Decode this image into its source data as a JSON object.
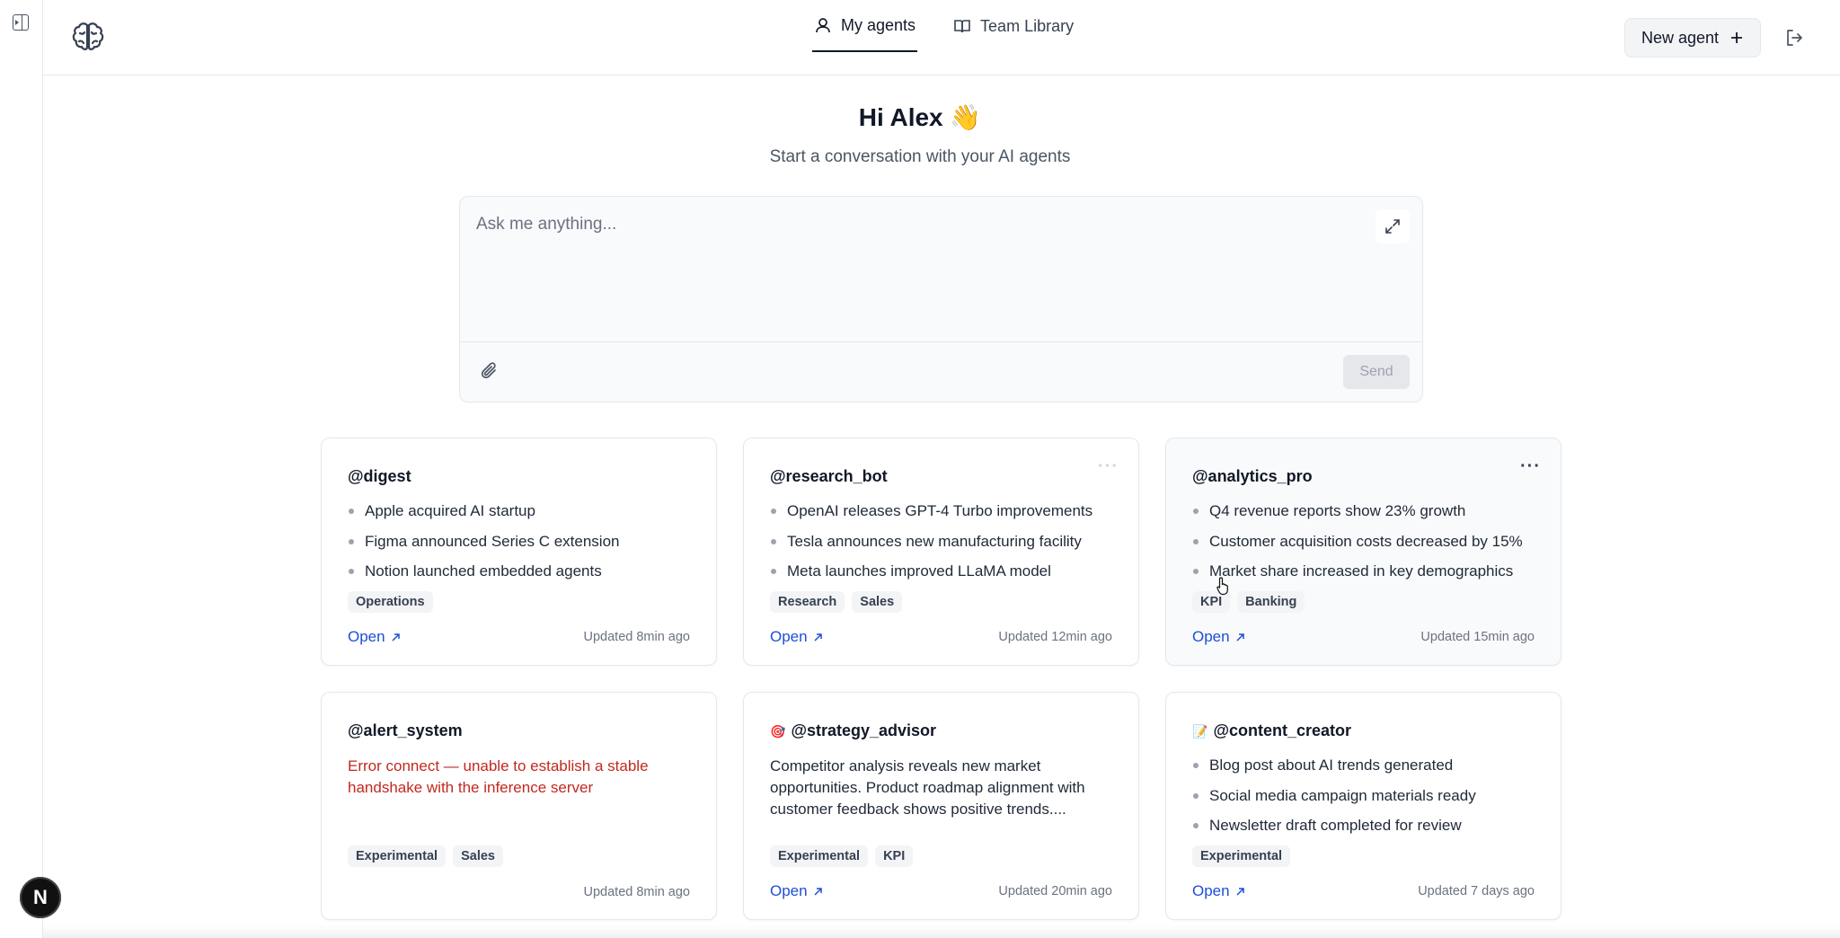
{
  "nav": {
    "tabs": [
      {
        "label": "My agents",
        "icon": "user-icon",
        "active": true
      },
      {
        "label": "Team Library",
        "icon": "book-icon",
        "active": false
      }
    ],
    "new_agent_label": "New agent",
    "new_agent_icon": "plus-icon"
  },
  "hero": {
    "greeting": "Hi Alex 👋",
    "subtitle": "Start a conversation with your AI agents"
  },
  "chat": {
    "placeholder": "Ask me anything...",
    "send_label": "Send"
  },
  "dev_badge": "N",
  "cards": [
    {
      "title": "@digest",
      "bullets": [
        "Apple acquired AI startup",
        "Figma announced Series C extension",
        "Notion launched embedded agents"
      ],
      "tags": [
        "Operations"
      ],
      "open_label": "Open",
      "updated": "Updated 8min ago"
    },
    {
      "title": "@research_bot",
      "bullets": [
        "OpenAI releases GPT-4 Turbo improvements",
        "Tesla announces new manufacturing facility",
        "Meta launches improved LLaMA model"
      ],
      "tags": [
        "Research",
        "Sales"
      ],
      "open_label": "Open",
      "updated": "Updated 12min ago"
    },
    {
      "title": "@analytics_pro",
      "bullets": [
        "Q4 revenue reports show 23% growth",
        "Customer acquisition costs decreased by 15%",
        "Market share increased in key demographics"
      ],
      "tags": [
        "KPI",
        "Banking"
      ],
      "open_label": "Open",
      "updated": "Updated 15min ago"
    },
    {
      "title": "@alert_system",
      "text": "Error connect — unable to establish a stable handshake with the inference server",
      "tags": [
        "Experimental",
        "Sales"
      ],
      "updated": "Updated 8min ago"
    },
    {
      "title": "@strategy_advisor",
      "emoji": "🎯",
      "text": "Competitor analysis reveals new market opportunities. Product roadmap alignment with customer feedback shows positive trends....",
      "tags": [
        "Experimental",
        "KPI"
      ],
      "open_label": "Open",
      "updated": "Updated 20min ago"
    },
    {
      "title": "@content_creator",
      "emoji": "📝",
      "bullets": [
        "Blog post about AI trends generated",
        "Social media campaign materials ready",
        "Newsletter draft completed for review"
      ],
      "tags": [
        "Experimental"
      ],
      "open_label": "Open",
      "updated": "Updated 7 days ago"
    }
  ],
  "colors": {
    "link": "#1d4ed8",
    "error": "#c2281f",
    "border": "#e5e7eb"
  }
}
